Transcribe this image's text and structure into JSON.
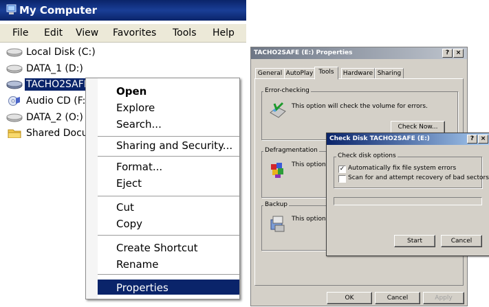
{
  "my_computer": {
    "title": "My Computer",
    "menu": [
      "File",
      "Edit",
      "View",
      "Favorites",
      "Tools",
      "Help"
    ],
    "drives": [
      {
        "label": "Local Disk (C:)",
        "icon": "hard-drive-icon"
      },
      {
        "label": "DATA_1 (D:)",
        "icon": "hard-drive-icon"
      },
      {
        "label": "TACHO2SAFE",
        "icon": "removable-drive-icon",
        "selected": true
      },
      {
        "label": "Audio CD (F:)",
        "icon": "cd-icon"
      },
      {
        "label": "DATA_2 (O:)",
        "icon": "hard-drive-icon"
      },
      {
        "label": "Shared Docum",
        "icon": "folder-icon"
      }
    ]
  },
  "context_menu": {
    "items": [
      "Open",
      "Explore",
      "Search...",
      "Sharing and Security...",
      "Format...",
      "Eject",
      "Cut",
      "Copy",
      "Create Shortcut",
      "Rename",
      "Properties"
    ],
    "selected": "Properties",
    "default": "Open"
  },
  "properties": {
    "title": "TACHO2SAFE (E:) Properties",
    "title_buttons": [
      "?",
      "×"
    ],
    "tabs": [
      "General",
      "AutoPlay",
      "Tools",
      "Hardware",
      "Sharing"
    ],
    "active_tab": "Tools",
    "error_checking": {
      "title": "Error-checking",
      "text": "This option will check the volume for errors.",
      "button": "Check Now..."
    },
    "defrag": {
      "title": "Defragmentation",
      "text": "This option v"
    },
    "backup": {
      "title": "Backup",
      "text": "This option v"
    },
    "buttons": {
      "ok": "OK",
      "cancel": "Cancel",
      "apply": "Apply"
    }
  },
  "check_disk": {
    "title": "Check Disk TACHO2SAFE (E:)",
    "title_buttons": [
      "?",
      "×"
    ],
    "group_title": "Check disk options",
    "options": [
      {
        "label": "Automatically fix file system errors",
        "checked": true
      },
      {
        "label": "Scan for and attempt recovery of bad sectors",
        "checked": false
      }
    ],
    "progress": 0,
    "buttons": {
      "start": "Start",
      "cancel": "Cancel"
    }
  },
  "colors": {
    "selection": "#0a246a",
    "dialog_face": "#d4d0c8",
    "inactive_title": "#6e7786"
  }
}
